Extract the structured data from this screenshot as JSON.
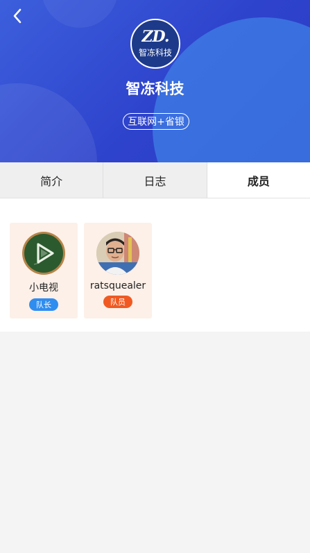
{
  "team": {
    "logo_mark": "ZD.",
    "logo_name": "智冻科技",
    "name": "智冻科技",
    "tag": "互联网+省银"
  },
  "tabs": [
    {
      "label": "简介",
      "active": false
    },
    {
      "label": "日志",
      "active": false
    },
    {
      "label": "成员",
      "active": true
    }
  ],
  "members": [
    {
      "name": "小电视",
      "role": "队长",
      "role_color": "#2f8df0",
      "avatar_icon": "play-chalkboard-avatar"
    },
    {
      "name": "ratsquealer",
      "role": "队员",
      "role_color": "#f05a22",
      "avatar_icon": "person-photo-avatar"
    }
  ],
  "colors": {
    "header_gradient_start": "#3c5fdc",
    "header_gradient_end": "#2a3bc4",
    "card_bg": "#fcf0e8",
    "page_bg": "#f4f4f4"
  }
}
